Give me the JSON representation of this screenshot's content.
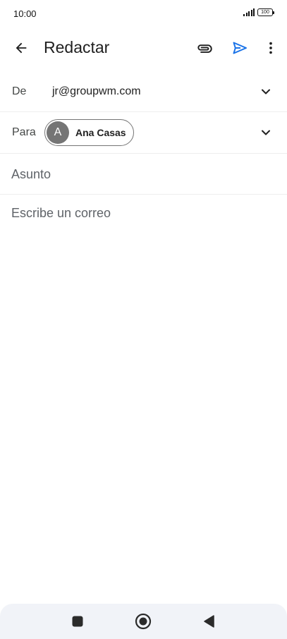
{
  "status_bar": {
    "time": "10:00",
    "battery": "100"
  },
  "app_bar": {
    "title": "Redactar",
    "back_icon": "arrow-back-icon",
    "attach_icon": "paperclip-icon",
    "send_icon": "send-icon",
    "more_icon": "more-vert-icon"
  },
  "compose": {
    "from_label": "De",
    "from_value": "jr@groupwm.com",
    "to_label": "Para",
    "recipient": {
      "initial": "A",
      "name": "Ana Casas"
    },
    "subject_placeholder": "Asunto",
    "body_placeholder": "Escribe un correo"
  },
  "colors": {
    "accent": "#1a73e8",
    "chip_avatar": "#757575"
  }
}
